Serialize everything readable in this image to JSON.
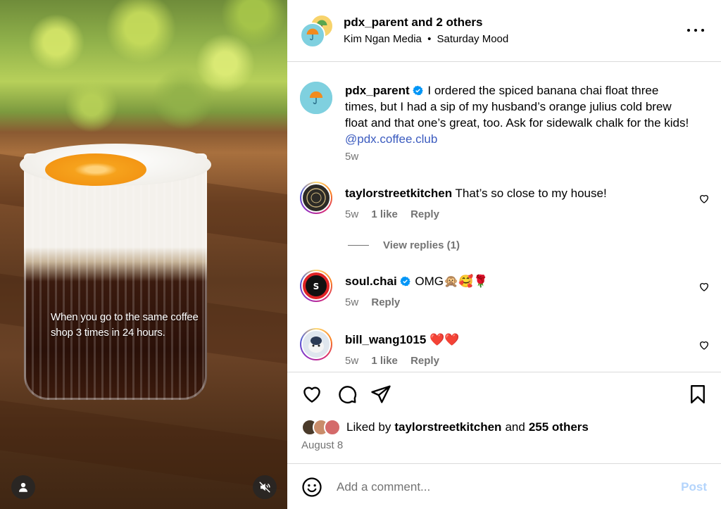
{
  "media": {
    "caption_line1": "When you go to the same coffee",
    "caption_line2": "shop 3 times in 24 hours.",
    "user_icon": "person-icon",
    "mute_icon": "muted-speaker-icon"
  },
  "header": {
    "author": "pdx_parent",
    "and_text": "and",
    "others": "2 others",
    "subtitle_left": "Kim Ngan Media",
    "subtitle_sep": "•",
    "subtitle_right": "Saturday Mood",
    "more_icon": "more-options-icon"
  },
  "caption": {
    "user": "pdx_parent",
    "text": "I ordered the spiced banana chai float three times, but I had a sip of my husband’s orange julius cold brew float and that one’s great, too. Ask for sidewalk chalk for the kids!",
    "mention": "@pdx.coffee.club",
    "time": "5w"
  },
  "comments": [
    {
      "user": "taylorstreetkitchen",
      "text": "That’s so close to my house!",
      "time": "5w",
      "likes": "1 like",
      "reply": "Reply"
    },
    {
      "user": "soul.chai",
      "text": "OMG🙊🥰🌹",
      "time": "5w",
      "reply": "Reply"
    },
    {
      "user": "bill_wang1015",
      "text": "❤️❤️",
      "time": "5w",
      "likes": "1 like",
      "reply": "Reply"
    }
  ],
  "view_replies": "View replies (1)",
  "likes": {
    "prefix": "Liked by",
    "user": "taylorstreetkitchen",
    "and_text": "and",
    "others": "255 others"
  },
  "date": "August 8",
  "add_comment": {
    "placeholder": "Add a comment...",
    "post_label": "Post"
  },
  "colors": {
    "link": "#3b5bbf",
    "muted": "#737373",
    "post_disabled": "#b3d4fc",
    "verified": "#0095f6"
  }
}
